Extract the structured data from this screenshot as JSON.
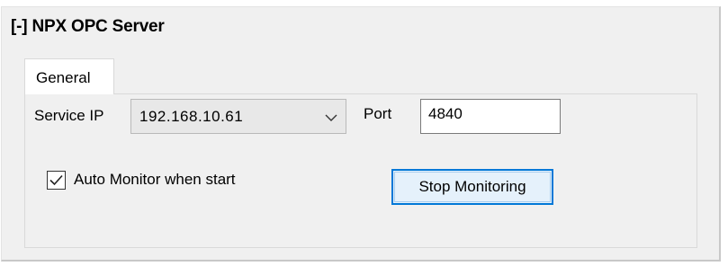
{
  "section": {
    "title": "[-] NPX OPC Server"
  },
  "tabs": [
    {
      "label": "General",
      "active": true
    }
  ],
  "general": {
    "service_ip_label": "Service IP",
    "service_ip_value": "192.168.10.61",
    "port_label": "Port",
    "port_value": "4840",
    "auto_monitor_label": "Auto Monitor when start",
    "auto_monitor_checked": true,
    "stop_button_label": "Stop Monitoring"
  },
  "colors": {
    "panel_bg": "#f0f0f0",
    "button_accent": "#0078d7",
    "button_bg": "#e5f1fb"
  },
  "icons": {
    "combo_arrow": "chevron-down-icon",
    "checkbox": "checkmark-icon"
  }
}
